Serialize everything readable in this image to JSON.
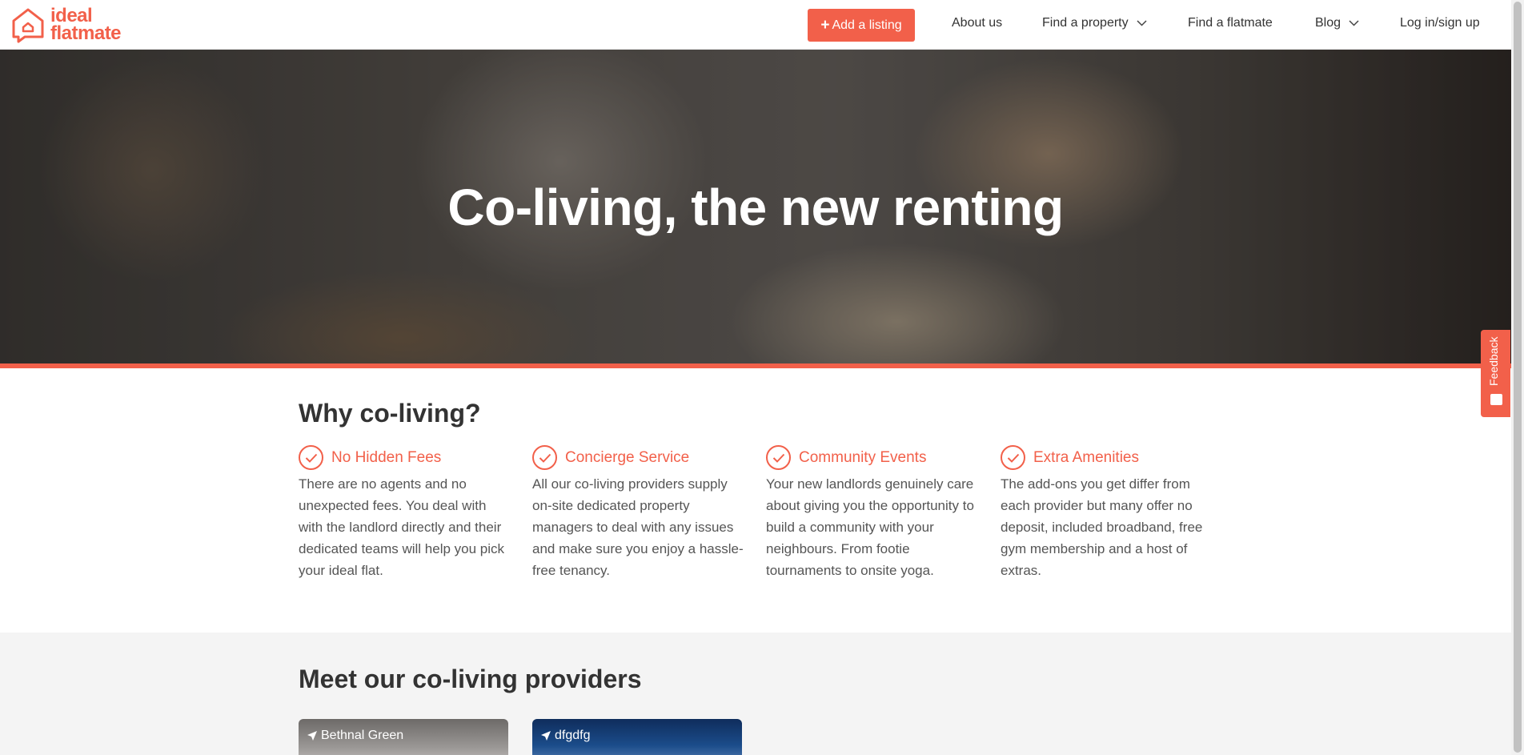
{
  "header": {
    "logo": {
      "line1": "ideal",
      "line2": "flatmate"
    },
    "add_listing": {
      "icon": "+",
      "label": "Add a listing"
    },
    "nav": {
      "about": "About us",
      "find_property": "Find a property",
      "find_flatmate": "Find a flatmate",
      "blog": "Blog",
      "login": "Log in/sign up"
    }
  },
  "hero": {
    "title": "Co-living, the new renting"
  },
  "why": {
    "title": "Why co-living?",
    "features": [
      {
        "title": "No Hidden Fees",
        "text": "There are no agents and no unexpected fees. You deal with with the landlord directly and their dedicated teams will help you pick your ideal flat."
      },
      {
        "title": "Concierge Service",
        "text": "All our co-living providers supply on-site dedicated property managers to deal with any issues and make sure you enjoy a hassle-free tenancy."
      },
      {
        "title": "Community Events",
        "text": "Your new landlords genuinely care about giving you the opportunity to build a community with your neighbours. From footie tournaments to onsite yoga."
      },
      {
        "title": "Extra Amenities",
        "text": "The add-ons you get differ from each provider but many offer no deposit, included broadband, free gym membership and a host of extras."
      }
    ]
  },
  "providers": {
    "title": "Meet our co-living providers",
    "cards": [
      {
        "location": "Bethnal Green"
      },
      {
        "location": "dfgdfg"
      }
    ]
  },
  "feedback": {
    "label": "Feedback"
  },
  "colors": {
    "accent": "#f2604a"
  }
}
